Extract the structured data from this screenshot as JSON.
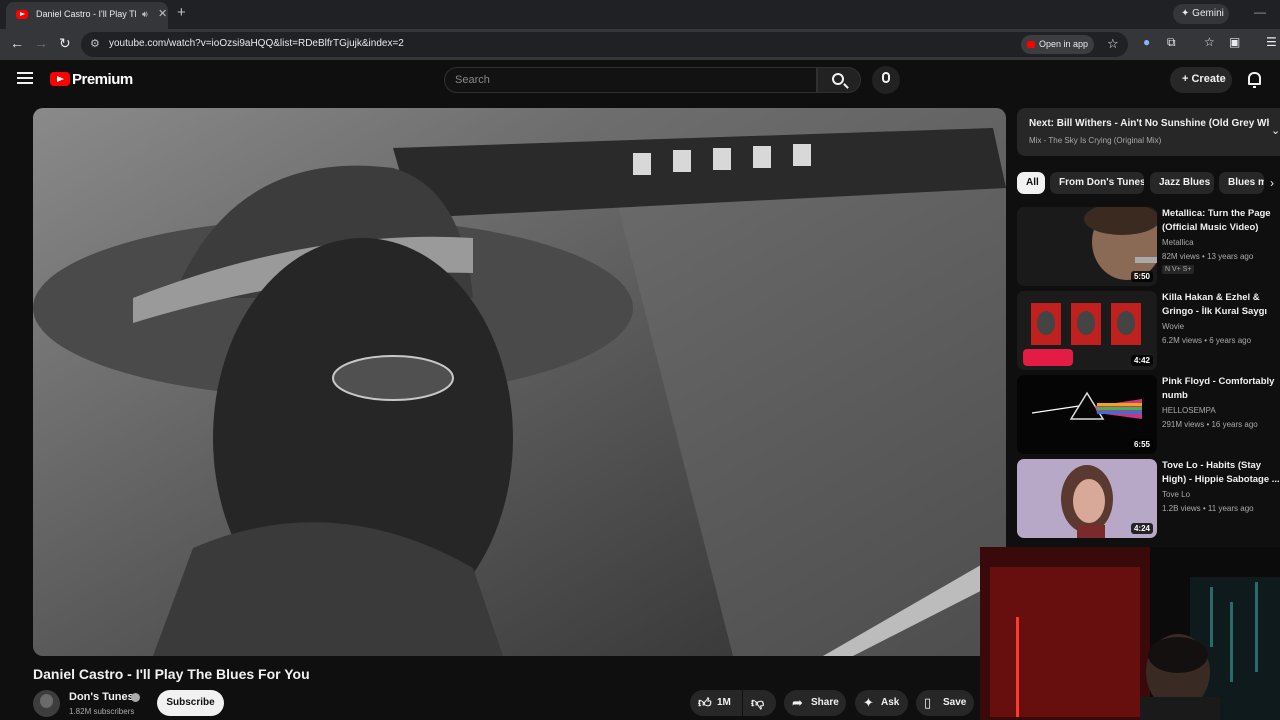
{
  "browser": {
    "tab_title": "Daniel Castro - I'll Play The",
    "url": "youtube.com/watch?v=ioOzsi9aHQQ&list=RDeBlfrTGjujk&index=2",
    "open_in_app": "Open in app",
    "gemini": "Gemini"
  },
  "header": {
    "logo": "Premium",
    "search_placeholder": "Search",
    "create": "Create"
  },
  "video": {
    "title": "Daniel Castro - I'll Play The Blues For You",
    "channel": "Don's Tunes",
    "subscribers": "1.82M subscribers",
    "subscribe": "Subscribe",
    "likes": "1M",
    "share": "Share",
    "ask": "Ask",
    "save": "Save"
  },
  "sidebar": {
    "next_title": "Next: Bill Withers - Ain't No Sunshine (Old Grey Whi...",
    "next_sub": "Mix - The Sky Is Crying (Original Mix)",
    "chips": [
      "All",
      "From Don's Tunes",
      "Jazz Blues",
      "Blues m"
    ],
    "recommendations": [
      {
        "title": "Metallica: Turn the Page (Official Music Video)",
        "channel": "Metallica",
        "meta": "82M views • 13 years ago",
        "duration": "5:50",
        "badge": "N V+ S+"
      },
      {
        "title": "Killa Hakan & Ezhel & Gringo - İlk Kural Saygı",
        "channel": "Wovie",
        "meta": "6.2M views • 6 years ago",
        "duration": "4:42"
      },
      {
        "title": "Pink Floyd - Comfortably numb",
        "channel": "HELLOSEMPA",
        "meta": "291M views • 16 years ago",
        "duration": "6:55"
      },
      {
        "title": "Tove Lo - Habits (Stay High) - Hippie Sabotage ...",
        "channel": "Tove Lo",
        "meta": "1.2B views • 11 years ago",
        "duration": "4:24"
      }
    ]
  },
  "colors": {
    "background": "#0f0f0f",
    "brand_red": "#ff0000",
    "chip_bg": "#272727"
  }
}
